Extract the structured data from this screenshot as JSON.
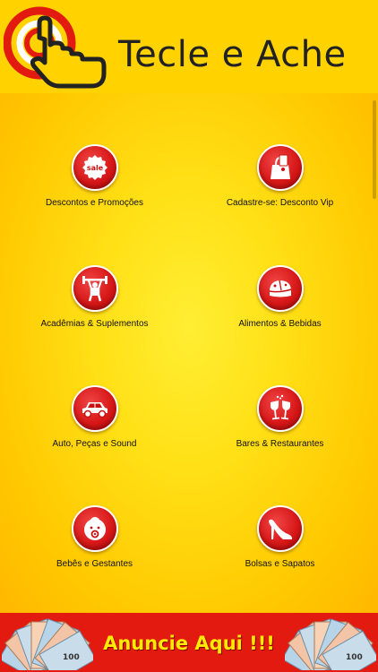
{
  "header": {
    "brand": "Tecle e Ache",
    "logo_icon": "pointing-hand-target-icon"
  },
  "categories": [
    {
      "label": "Descontos e Promoções",
      "icon": "sale-tag-icon"
    },
    {
      "label": "Cadastre-se: Desconto Vip",
      "icon": "shopping-bag-icon"
    },
    {
      "label": "Acadêmias & Suplementos",
      "icon": "weightlifter-icon"
    },
    {
      "label": "Alimentos & Bebidas",
      "icon": "cheese-icon"
    },
    {
      "label": "Auto, Peças e Sound",
      "icon": "car-icon"
    },
    {
      "label": "Bares & Restaurantes",
      "icon": "wine-glasses-icon"
    },
    {
      "label": "Bebês e Gestantes",
      "icon": "baby-icon"
    },
    {
      "label": "Bolsas e Sapatos",
      "icon": "high-heel-icon"
    }
  ],
  "sale_icon_text": "sale",
  "banner": {
    "text": "Anuncie Aqui !!!",
    "money_icon": "money-fan-icon",
    "money_note_text": "100"
  },
  "colors": {
    "background": "#ffd200",
    "button": "#d81818",
    "banner": "#e21a10",
    "banner_text": "#ffeb00"
  }
}
